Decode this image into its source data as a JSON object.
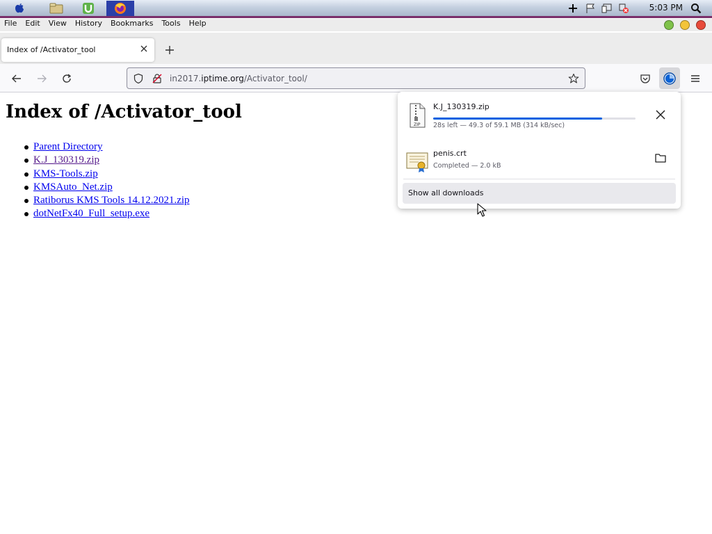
{
  "os_panel": {
    "clock": "5:03 PM",
    "launchers": [
      "apple-menu-icon",
      "file-manager-icon",
      "torrent-client-icon",
      "firefox-icon"
    ]
  },
  "menubar": {
    "items": [
      "File",
      "Edit",
      "View",
      "History",
      "Bookmarks",
      "Tools",
      "Help"
    ]
  },
  "tab": {
    "title": "Index of /Activator_tool"
  },
  "urlbar": {
    "prefix": "in2017.",
    "host": "iptime.org",
    "path": "/Activator_tool/"
  },
  "page": {
    "title": "Index of /Activator_tool",
    "links": [
      {
        "label": "Parent Directory",
        "visited": false
      },
      {
        "label": "K.J_130319.zip",
        "visited": true
      },
      {
        "label": "KMS-Tools.zip",
        "visited": false
      },
      {
        "label": "KMSAuto_Net.zip",
        "visited": false
      },
      {
        "label": "Ratiborus KMS Tools 14.12.2021.zip",
        "visited": false
      },
      {
        "label": "dotNetFx40_Full_setup.exe",
        "visited": false
      }
    ]
  },
  "downloads": {
    "items": [
      {
        "name": "K.J_130319.zip",
        "status": "28s left — 49.3 of 59.1 MB (314 kB/sec)",
        "progress_fraction": 0.834,
        "icon": "zip-file-icon",
        "action": "cancel"
      },
      {
        "name": "penis.crt",
        "status": "Completed — 2.0 kB",
        "icon": "certificate-file-icon",
        "action": "open-folder"
      }
    ],
    "show_all_label": "Show all downloads"
  },
  "colors": {
    "accent_blue": "#0061e0",
    "link": "#0000ee",
    "visited_link": "#551a8b"
  }
}
